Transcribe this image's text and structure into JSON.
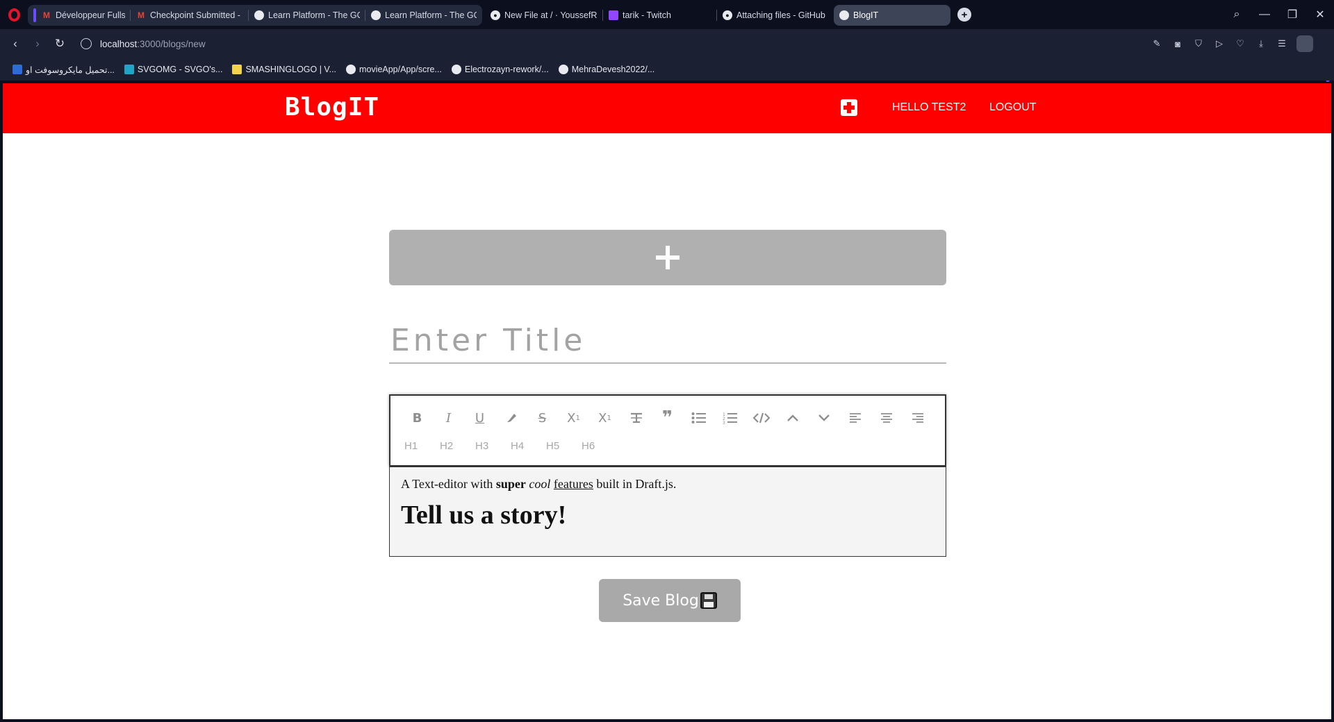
{
  "browser": {
    "tabs": [
      {
        "label": "Développeur Fullstack js -",
        "favicon": "gmail-icon"
      },
      {
        "label": "Checkpoint Submitted - C",
        "favicon": "gmail-icon"
      },
      {
        "label": "Learn Platform - The GOM",
        "favicon": "globe-icon"
      },
      {
        "label": "Learn Platform - The GOM",
        "favicon": "globe-icon"
      },
      {
        "label": "New File at / · YoussefRs/I",
        "favicon": "github-icon"
      },
      {
        "label": "tarik - Twitch",
        "favicon": "twitch-icon"
      },
      {
        "label": "Attaching files - GitHub D",
        "favicon": "github-icon"
      },
      {
        "label": "BlogIT",
        "favicon": "globe-icon",
        "active": true
      }
    ],
    "url_host": "localhost",
    "url_path": ":3000/blogs/new",
    "bookmarks": [
      {
        "label": "تحميل مايكروسوفت او...",
        "favicon": "microsoft-icon"
      },
      {
        "label": "SVGOMG - SVGO's...",
        "favicon": "svgomg-icon"
      },
      {
        "label": "SMASHINGLOGO | V...",
        "favicon": "smashinglogo-icon"
      },
      {
        "label": "movieApp/App/scre...",
        "favicon": "github-icon"
      },
      {
        "label": "Electrozayn-rework/...",
        "favicon": "github-icon"
      },
      {
        "label": "MehraDevesh2022/...",
        "favicon": "github-icon"
      }
    ]
  },
  "navbar": {
    "brand": "BlogIT",
    "greeting": "HELLO TEST2",
    "logout": "LOGOUT",
    "brand_color": "#ff0000"
  },
  "form": {
    "title_placeholder": "Enter Title",
    "toolbar": {
      "row1": [
        "bold-icon",
        "italic-icon",
        "underline-icon",
        "highlight-icon",
        "strikethrough-icon",
        "superscript-icon",
        "subscript-icon",
        "clear-format-icon",
        "blockquote-icon",
        "unordered-list-icon",
        "ordered-list-icon",
        "code-block-icon",
        "move-up-icon",
        "move-down-icon",
        "align-left-icon",
        "align-center-icon",
        "align-right-icon"
      ],
      "headings": [
        "H1",
        "H2",
        "H3",
        "H4",
        "H5",
        "H6"
      ]
    },
    "editor": {
      "intro_plain1": "A Text-editor with ",
      "intro_bold": "super",
      "intro_italic": "cool",
      "intro_underline": "features",
      "intro_plain2": " built in Draft.js.",
      "heading": "Tell us a story!"
    },
    "save_label": "Save Blog"
  }
}
